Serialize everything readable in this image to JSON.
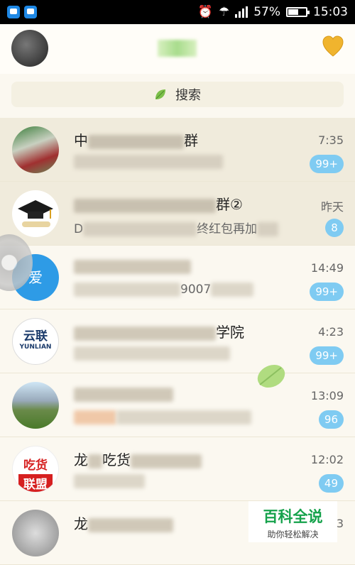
{
  "status_bar": {
    "battery": "57%",
    "battery_level": 0.57,
    "time": "15:03"
  },
  "search": {
    "label": "搜索"
  },
  "conversations": [
    {
      "name": "中",
      "name_tail": "群",
      "message": "",
      "time": "7:35",
      "badge": "99+",
      "pinned": true
    },
    {
      "name": "",
      "name_tail": "群②",
      "message": "D",
      "message_tail": "终红包再加",
      "time": "昨天",
      "badge": "8",
      "pinned": true
    },
    {
      "name": "",
      "name_tail": "",
      "message": "",
      "message_tail": "9007",
      "time": "14:49",
      "badge": "99+",
      "pinned": false
    },
    {
      "name": "",
      "name_tail": "学院",
      "message": "",
      "message_tail": "",
      "time": "4:23",
      "badge": "99+",
      "pinned": false
    },
    {
      "name": "",
      "name_tail": "",
      "message": "",
      "message_tail": "",
      "time": "13:09",
      "badge": "96",
      "pinned": false
    },
    {
      "name": "龙",
      "name_tail": "吃货",
      "message": "",
      "message_tail": "",
      "time": "12:02",
      "badge": "49",
      "pinned": false
    },
    {
      "name": "龙",
      "name_tail": "",
      "message": "",
      "message_tail": "",
      "time": "3",
      "badge": "",
      "pinned": false
    }
  ],
  "avatars": {
    "row2": {
      "label": "爱"
    },
    "row3": {
      "label1": "云联",
      "label2": "YUNLIAN"
    },
    "row5": {
      "label1": "吃货",
      "label2": "联盟"
    }
  },
  "watermark": {
    "title": "百科全说",
    "subtitle": "助你轻松解决"
  }
}
